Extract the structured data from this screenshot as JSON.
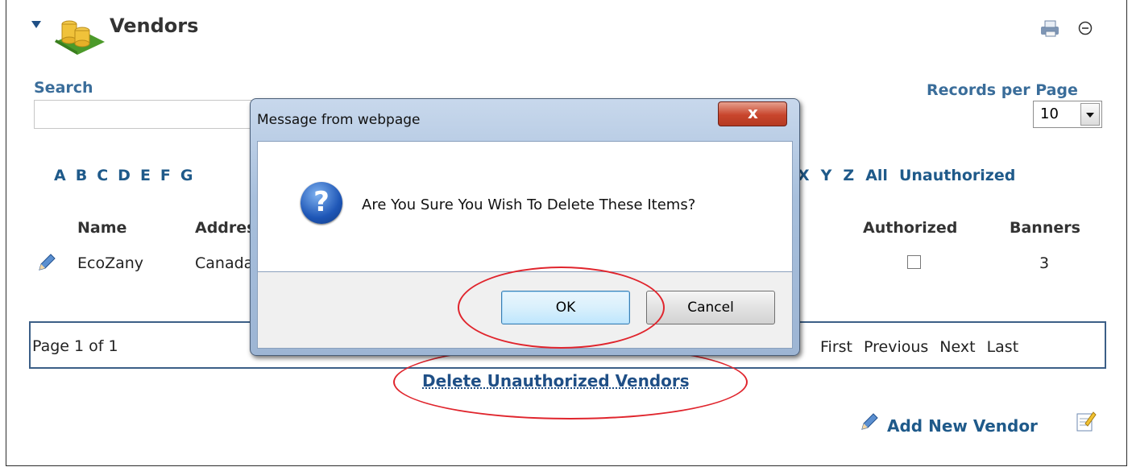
{
  "module": {
    "title": "Vendors"
  },
  "search": {
    "label": "Search",
    "value": ""
  },
  "records_per_page": {
    "label": "Records per Page",
    "value": "10"
  },
  "alphabet": {
    "letters_left": [
      "A",
      "B",
      "C",
      "D",
      "E",
      "F",
      "G"
    ],
    "letters_right": [
      "X",
      "Y",
      "Z"
    ],
    "all": "All",
    "unauthorized": "Unauthorized"
  },
  "table": {
    "headers": {
      "name": "Name",
      "address": "Address",
      "authorized": "Authorized",
      "banners": "Banners"
    },
    "rows": [
      {
        "name": "EcoZany",
        "address": "Canada",
        "authorized": false,
        "banners": "3"
      }
    ]
  },
  "pager": {
    "page_info": "Page 1 of 1",
    "first": "First",
    "previous": "Previous",
    "next": "Next",
    "last": "Last"
  },
  "actions": {
    "delete_unauthorized": "Delete Unauthorized Vendors",
    "add_new": "Add New Vendor"
  },
  "dialog": {
    "title": "Message from webpage",
    "close": "x",
    "message": "Are You Sure You Wish To Delete These Items?",
    "ok": "OK",
    "cancel": "Cancel",
    "icon": "question-icon"
  },
  "colors": {
    "link": "#1f5a8a",
    "highlight": "#e0252d",
    "pager_border": "#3c5f87"
  }
}
